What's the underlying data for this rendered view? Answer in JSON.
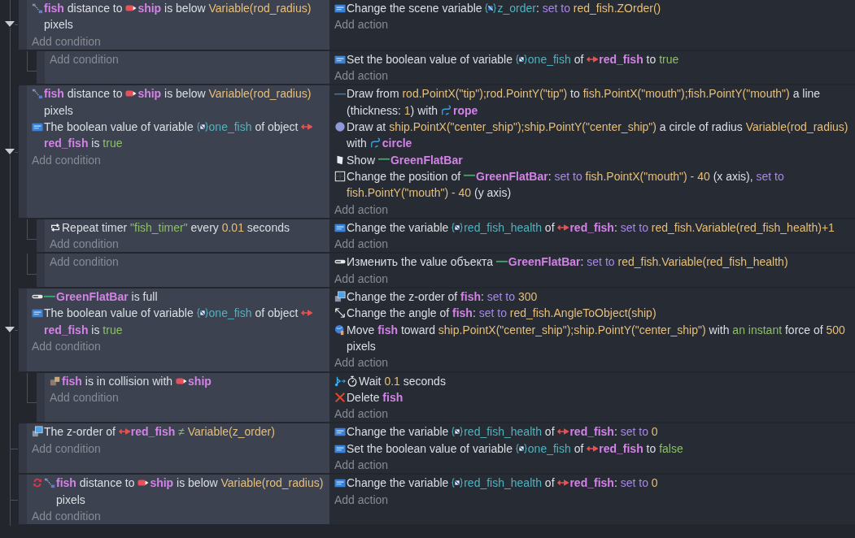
{
  "events": [
    {
      "expanded": true,
      "add_condition": "Add condition",
      "add_action": "Add action",
      "conditions": [
        {
          "kind": "distance",
          "parts": [
            {
              "kind": "object",
              "text": "fish"
            },
            {
              "kind": "text",
              "text": " distance to "
            },
            {
              "kind": "object_ship",
              "text": "ship"
            },
            {
              "kind": "text",
              "text": " is below "
            },
            {
              "kind": "param",
              "text": "Variable(rod_radius)"
            },
            {
              "kind": "text",
              "text": " pixels"
            }
          ]
        }
      ],
      "actions": [
        {
          "kind": "variable",
          "parts": [
            {
              "kind": "text",
              "text": "Change the scene variable "
            },
            {
              "kind": "scene_var",
              "text": "z_order"
            },
            {
              "kind": "text",
              "text": ": "
            },
            {
              "kind": "keyword",
              "text": "set to"
            },
            {
              "kind": "param",
              "text": " red_fish.ZOrder()"
            }
          ]
        }
      ],
      "children": [
        {
          "add_condition": "Add condition",
          "add_action": "Add action",
          "actions": [
            {
              "kind": "variable",
              "parts": [
                {
                  "kind": "text",
                  "text": "Set the boolean value of variable "
                },
                {
                  "kind": "var",
                  "text": "one_fish"
                },
                {
                  "kind": "text",
                  "text": " of "
                },
                {
                  "kind": "object_fish",
                  "text": "red_fish"
                },
                {
                  "kind": "text",
                  "text": " to "
                },
                {
                  "kind": "choice",
                  "text": "true"
                }
              ]
            }
          ]
        }
      ]
    },
    {
      "expanded": true,
      "add_condition": "Add condition",
      "add_action": "Add action",
      "conditions": [
        {
          "kind": "distance",
          "parts": [
            {
              "kind": "object",
              "text": "fish"
            },
            {
              "kind": "text",
              "text": " distance to "
            },
            {
              "kind": "object_ship",
              "text": "ship"
            },
            {
              "kind": "text",
              "text": " is below "
            },
            {
              "kind": "param",
              "text": "Variable(rod_radius)"
            },
            {
              "kind": "text",
              "text": " pixels"
            }
          ]
        },
        {
          "kind": "variable",
          "parts": [
            {
              "kind": "text",
              "text": "The boolean value of variable "
            },
            {
              "kind": "var",
              "text": "one_fish"
            },
            {
              "kind": "text",
              "text": " of object "
            },
            {
              "kind": "object_fish",
              "text": "red_fish"
            },
            {
              "kind": "text",
              "text": " is "
            },
            {
              "kind": "choice",
              "text": "true"
            }
          ]
        }
      ],
      "actions": [
        {
          "kind": "line",
          "parts": [
            {
              "kind": "text",
              "text": "Draw from "
            },
            {
              "kind": "param",
              "text": "rod.PointX(\"tip\");rod.PointY(\"tip\")"
            },
            {
              "kind": "text",
              "text": " to "
            },
            {
              "kind": "param",
              "text": "fish.PointX(\"mouth\");fish.PointY(\"mouth\")"
            },
            {
              "kind": "text",
              "text": " a line (thickness: "
            },
            {
              "kind": "param",
              "text": "1"
            },
            {
              "kind": "text",
              "text": ") with "
            },
            {
              "kind": "object_painter",
              "text": "rope"
            }
          ]
        },
        {
          "kind": "circle",
          "parts": [
            {
              "kind": "text",
              "text": "Draw at "
            },
            {
              "kind": "param",
              "text": "ship.PointX(\"center_ship\");ship.PointY(\"center_ship\")"
            },
            {
              "kind": "text",
              "text": " a circle of radius "
            },
            {
              "kind": "param",
              "text": "Variable(rod_radius)"
            },
            {
              "kind": "text",
              "text": " with "
            },
            {
              "kind": "object_painter",
              "text": "circle"
            }
          ]
        },
        {
          "kind": "show",
          "parts": [
            {
              "kind": "text",
              "text": "Show "
            },
            {
              "kind": "object_bar",
              "text": "GreenFlatBar"
            }
          ]
        },
        {
          "kind": "position",
          "parts": [
            {
              "kind": "text",
              "text": "Change the position of "
            },
            {
              "kind": "object_bar",
              "text": "GreenFlatBar"
            },
            {
              "kind": "text",
              "text": ": "
            },
            {
              "kind": "keyword",
              "text": "set to"
            },
            {
              "kind": "param",
              "text": " fish.PointX(\"mouth\") - 40"
            },
            {
              "kind": "text",
              "text": " (x axis), "
            },
            {
              "kind": "keyword",
              "text": "set to"
            },
            {
              "kind": "param",
              "text": " fish.PointY(\"mouth\") - 40"
            },
            {
              "kind": "text",
              "text": " (y axis)"
            }
          ]
        }
      ],
      "children": [
        {
          "add_condition": "Add condition",
          "add_action": "Add action",
          "conditions": [
            {
              "kind": "timer",
              "parts": [
                {
                  "kind": "text",
                  "text": "Repeat timer "
                },
                {
                  "kind": "choice",
                  "text": "\"fish_timer\""
                },
                {
                  "kind": "text",
                  "text": " every "
                },
                {
                  "kind": "param",
                  "text": "0.01"
                },
                {
                  "kind": "text",
                  "text": " seconds"
                }
              ]
            }
          ],
          "actions": [
            {
              "kind": "variable",
              "parts": [
                {
                  "kind": "text",
                  "text": "Change the variable "
                },
                {
                  "kind": "var",
                  "text": "red_fish_health"
                },
                {
                  "kind": "text",
                  "text": " of "
                },
                {
                  "kind": "object_fish",
                  "text": "red_fish"
                },
                {
                  "kind": "text",
                  "text": ": "
                },
                {
                  "kind": "keyword",
                  "text": "set to"
                },
                {
                  "kind": "param",
                  "text": " red_fish.Variable(red_fish_health)+1"
                }
              ]
            }
          ]
        },
        {
          "add_condition": "Add condition",
          "add_action": "Add action",
          "actions": [
            {
              "kind": "slider",
              "parts": [
                {
                  "kind": "text",
                  "text": "Изменить the value объекта "
                },
                {
                  "kind": "object_bar",
                  "text": "GreenFlatBar"
                },
                {
                  "kind": "text",
                  "text": ": "
                },
                {
                  "kind": "keyword",
                  "text": "set to"
                },
                {
                  "kind": "param",
                  "text": " red_fish.Variable(red_fish_health)"
                }
              ]
            }
          ]
        }
      ]
    },
    {
      "expanded": true,
      "add_condition": "Add condition",
      "add_action": "Add action",
      "conditions": [
        {
          "kind": "slider",
          "parts": [
            {
              "kind": "object_bar",
              "text": "GreenFlatBar"
            },
            {
              "kind": "text",
              "text": " is full"
            }
          ]
        },
        {
          "kind": "variable",
          "parts": [
            {
              "kind": "text",
              "text": "The boolean value of variable "
            },
            {
              "kind": "var",
              "text": "one_fish"
            },
            {
              "kind": "text",
              "text": " of object "
            },
            {
              "kind": "object_fish",
              "text": "red_fish"
            },
            {
              "kind": "text",
              "text": " is "
            },
            {
              "kind": "choice",
              "text": "true"
            }
          ]
        }
      ],
      "actions": [
        {
          "kind": "zorder",
          "parts": [
            {
              "kind": "text",
              "text": "Change the z-order of "
            },
            {
              "kind": "object",
              "text": "fish"
            },
            {
              "kind": "text",
              "text": ": "
            },
            {
              "kind": "keyword",
              "text": "set to"
            },
            {
              "kind": "param",
              "text": " 300"
            }
          ]
        },
        {
          "kind": "angle",
          "parts": [
            {
              "kind": "text",
              "text": "Change the angle of "
            },
            {
              "kind": "object",
              "text": "fish"
            },
            {
              "kind": "text",
              "text": ": "
            },
            {
              "kind": "keyword",
              "text": "set to"
            },
            {
              "kind": "param",
              "text": " red_fish.AngleToObject(ship)"
            }
          ]
        },
        {
          "kind": "move",
          "parts": [
            {
              "kind": "text",
              "text": "Move "
            },
            {
              "kind": "object",
              "text": "fish"
            },
            {
              "kind": "text",
              "text": " toward "
            },
            {
              "kind": "param",
              "text": "ship.PointX(\"center_ship\");ship.PointY(\"center_ship\")"
            },
            {
              "kind": "text",
              "text": " with "
            },
            {
              "kind": "choice",
              "text": "an instant"
            },
            {
              "kind": "text",
              "text": " force of "
            },
            {
              "kind": "param",
              "text": "500"
            },
            {
              "kind": "text",
              "text": " pixels"
            }
          ]
        }
      ],
      "children": [
        {
          "add_condition": "Add condition",
          "add_action": "Add action",
          "conditions": [
            {
              "kind": "collision",
              "parts": [
                {
                  "kind": "object",
                  "text": "fish"
                },
                {
                  "kind": "text",
                  "text": " is in collision with "
                },
                {
                  "kind": "object_ship",
                  "text": "ship"
                }
              ]
            }
          ],
          "actions": [
            {
              "kind": "wait",
              "parts": [
                {
                  "kind": "text",
                  "text": "Wait "
                },
                {
                  "kind": "param",
                  "text": "0.1"
                },
                {
                  "kind": "text",
                  "text": " seconds"
                }
              ]
            },
            {
              "kind": "delete",
              "parts": [
                {
                  "kind": "text",
                  "text": "Delete "
                },
                {
                  "kind": "object",
                  "text": "fish"
                }
              ]
            }
          ]
        }
      ]
    },
    {
      "add_condition": "Add condition",
      "add_action": "Add action",
      "conditions": [
        {
          "kind": "zorder",
          "parts": [
            {
              "kind": "text",
              "text": "The z-order of "
            },
            {
              "kind": "object_fish",
              "text": "red_fish"
            },
            {
              "kind": "choice",
              "text": " ≠"
            },
            {
              "kind": "param",
              "text": " Variable(z_order)"
            }
          ]
        }
      ],
      "actions": [
        {
          "kind": "variable",
          "parts": [
            {
              "kind": "text",
              "text": "Change the variable "
            },
            {
              "kind": "var",
              "text": "red_fish_health"
            },
            {
              "kind": "text",
              "text": " of "
            },
            {
              "kind": "object_fish",
              "text": "red_fish"
            },
            {
              "kind": "text",
              "text": ": "
            },
            {
              "kind": "keyword",
              "text": "set to"
            },
            {
              "kind": "param",
              "text": " 0"
            }
          ]
        },
        {
          "kind": "variable",
          "parts": [
            {
              "kind": "text",
              "text": "Set the boolean value of variable "
            },
            {
              "kind": "var",
              "text": "one_fish"
            },
            {
              "kind": "text",
              "text": " of "
            },
            {
              "kind": "object_fish",
              "text": "red_fish"
            },
            {
              "kind": "text",
              "text": " to "
            },
            {
              "kind": "choice",
              "text": "false"
            }
          ]
        }
      ]
    },
    {
      "add_condition": "Add condition",
      "add_action": "Add action",
      "conditions": [
        {
          "kind": "distance_once",
          "parts": [
            {
              "kind": "object",
              "text": "fish"
            },
            {
              "kind": "text",
              "text": " distance to "
            },
            {
              "kind": "object_ship",
              "text": "ship"
            },
            {
              "kind": "text",
              "text": " is below "
            },
            {
              "kind": "param",
              "text": "Variable(rod_radius)"
            },
            {
              "kind": "text",
              "text": " pixels"
            }
          ]
        }
      ],
      "actions": [
        {
          "kind": "variable",
          "parts": [
            {
              "kind": "text",
              "text": "Change the variable "
            },
            {
              "kind": "var",
              "text": "red_fish_health"
            },
            {
              "kind": "text",
              "text": " of "
            },
            {
              "kind": "object_fish",
              "text": "red_fish"
            },
            {
              "kind": "text",
              "text": ": "
            },
            {
              "kind": "keyword",
              "text": "set to"
            },
            {
              "kind": "param",
              "text": " 0"
            }
          ]
        }
      ]
    }
  ]
}
